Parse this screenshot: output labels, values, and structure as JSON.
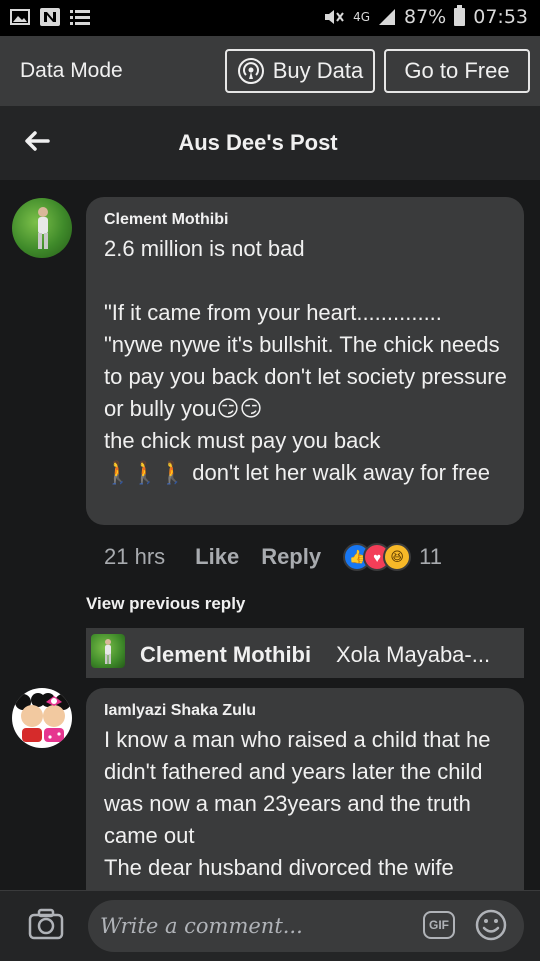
{
  "status_bar": {
    "signal": "4G",
    "battery": "87%",
    "time": "07:53"
  },
  "data_mode": {
    "label": "Data Mode",
    "buy_label": "Buy Data",
    "free_label": "Go to Free"
  },
  "header": {
    "title": "Aus Dee's Post"
  },
  "comments": [
    {
      "author": "Clement  Mothibi",
      "text": "2.6 million is not bad\n\n\"If it came from your heart..............\n\"nywe nywe it's bullshit. The chick needs to pay you back don't let society pressure or bully you😏😏\nthe chick must pay you back\n🚶🚶🚶 don't let her walk away for free",
      "time": "21 hrs",
      "like_label": "Like",
      "reply_label": "Reply",
      "reaction_icons": [
        "like-icon",
        "love-icon",
        "haha-icon"
      ],
      "reaction_count": "11",
      "view_previous": "View previous reply",
      "reply_preview": {
        "author": "Clement  Mothibi",
        "text": "Xola Mayaba-..."
      }
    },
    {
      "author": "Iamlyazi Shaka Zulu",
      "text": "I know a man who raised a child that he didn't fathered and years later the child was now a man 23years and the truth came out\nThe dear husband divorced the wife"
    }
  ],
  "composer": {
    "placeholder": "Write a comment...",
    "gif_label": "GIF"
  }
}
